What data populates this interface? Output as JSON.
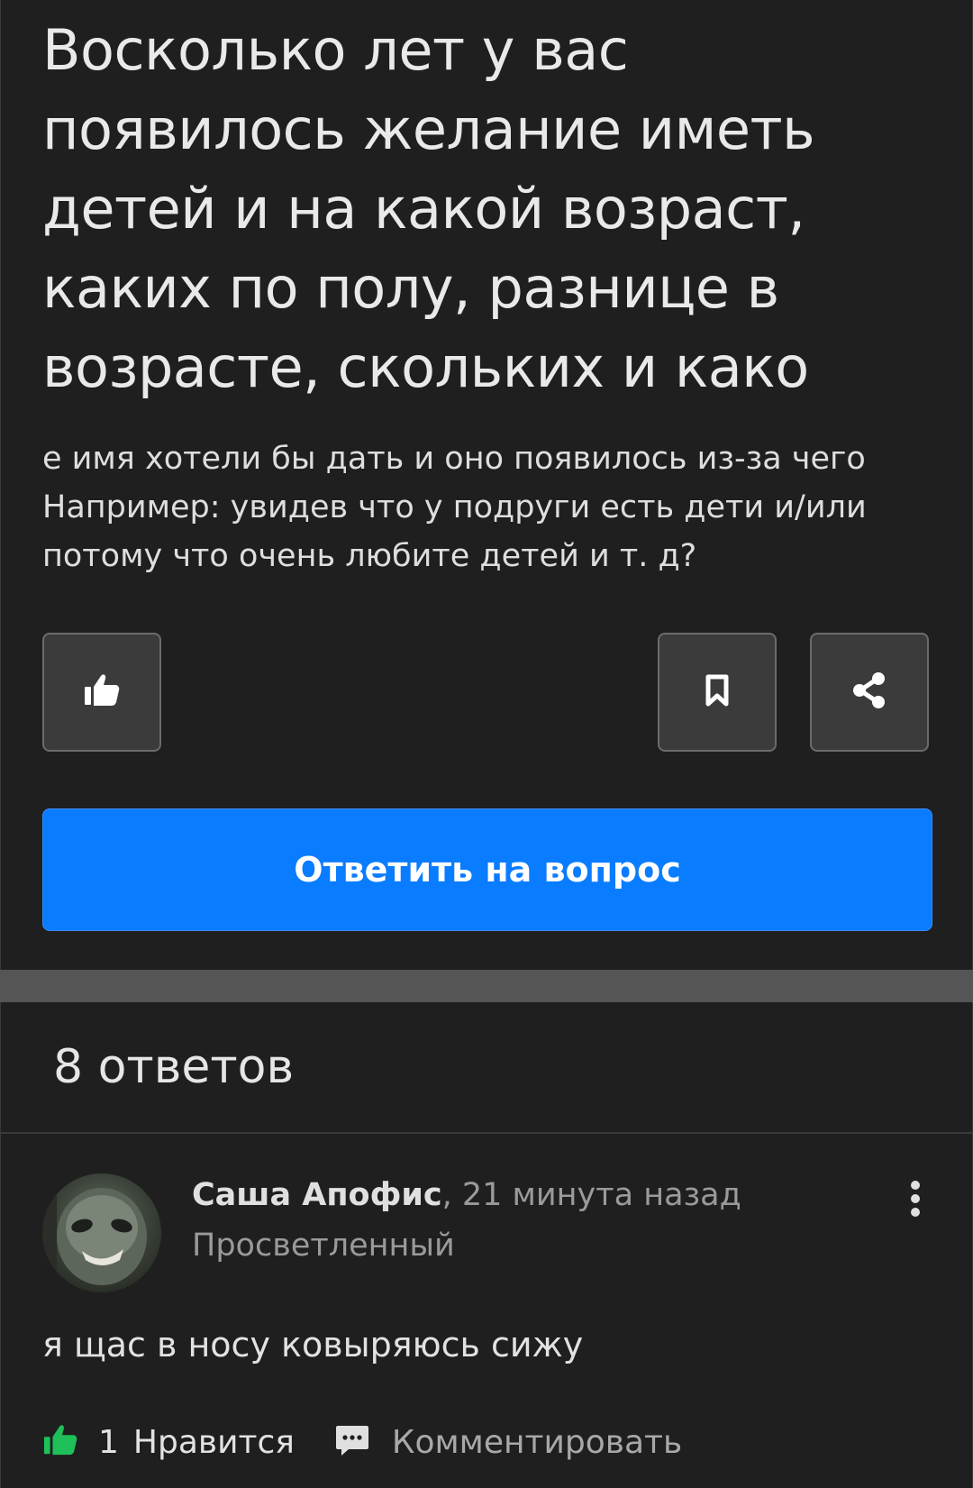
{
  "question": {
    "title": "Восколько лет у вас появилось желание иметь детей и на какой возраст, каких по полу, разнице в возрасте, скольких и како",
    "body": "е имя хотели бы дать и оно появилось из-за чего Например: увидев что у подруги есть дети и/или потому что очень любите детей и т. д?",
    "actions": {
      "like_icon": "thumbs-up-icon",
      "bookmark_icon": "bookmark-icon",
      "share_icon": "share-icon"
    },
    "answer_button_label": "Ответить на вопрос"
  },
  "answers": {
    "count_label": "8 ответов",
    "items": [
      {
        "author": "Саша Апофис",
        "separator": ", ",
        "time": "21 минута назад",
        "rank": "Просветленный",
        "text": "я щас в носу ковыряюсь сижу",
        "likes": "1",
        "like_label": "Нравится",
        "comment_label": "Комментировать"
      }
    ]
  },
  "colors": {
    "background": "#1f1f1f",
    "accent_blue": "#0a7cff",
    "like_green": "#1fbf5a"
  }
}
